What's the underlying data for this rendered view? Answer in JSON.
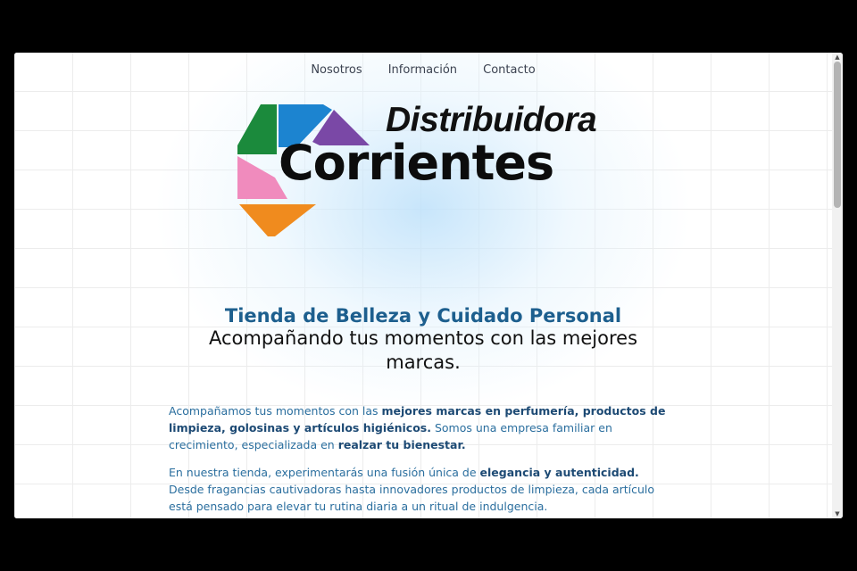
{
  "nav": {
    "items": [
      "Nosotros",
      "Información",
      "Contacto"
    ]
  },
  "logo": {
    "word1": "Distribuidora",
    "word2": "Corrientes",
    "colors": [
      "#1b8a3c",
      "#1c84d0",
      "#7a48a6",
      "#f08bbd",
      "#f08b1e"
    ]
  },
  "hero": {
    "title": "Tienda de Belleza y Cuidado Personal",
    "subtitle": "Acompañando tus momentos con las mejores marcas."
  },
  "content": {
    "p1": {
      "t1": "Acompañamos tus momentos con las ",
      "b1": "mejores marcas en perfumería, productos de limpieza, golosinas y artículos higiénicos.",
      "t2": " Somos una empresa familiar en crecimiento, especializada en ",
      "b2": "realzar tu bienestar."
    },
    "p2": {
      "t1": "En nuestra tienda, experimentarás una fusión única de ",
      "b1": "elegancia y autenticidad.",
      "t2": " Desde fragancias cautivadoras hasta innovadores productos de limpieza, cada artículo está pensado para elevar tu rutina diaria a un ritual de indulgencia."
    }
  }
}
